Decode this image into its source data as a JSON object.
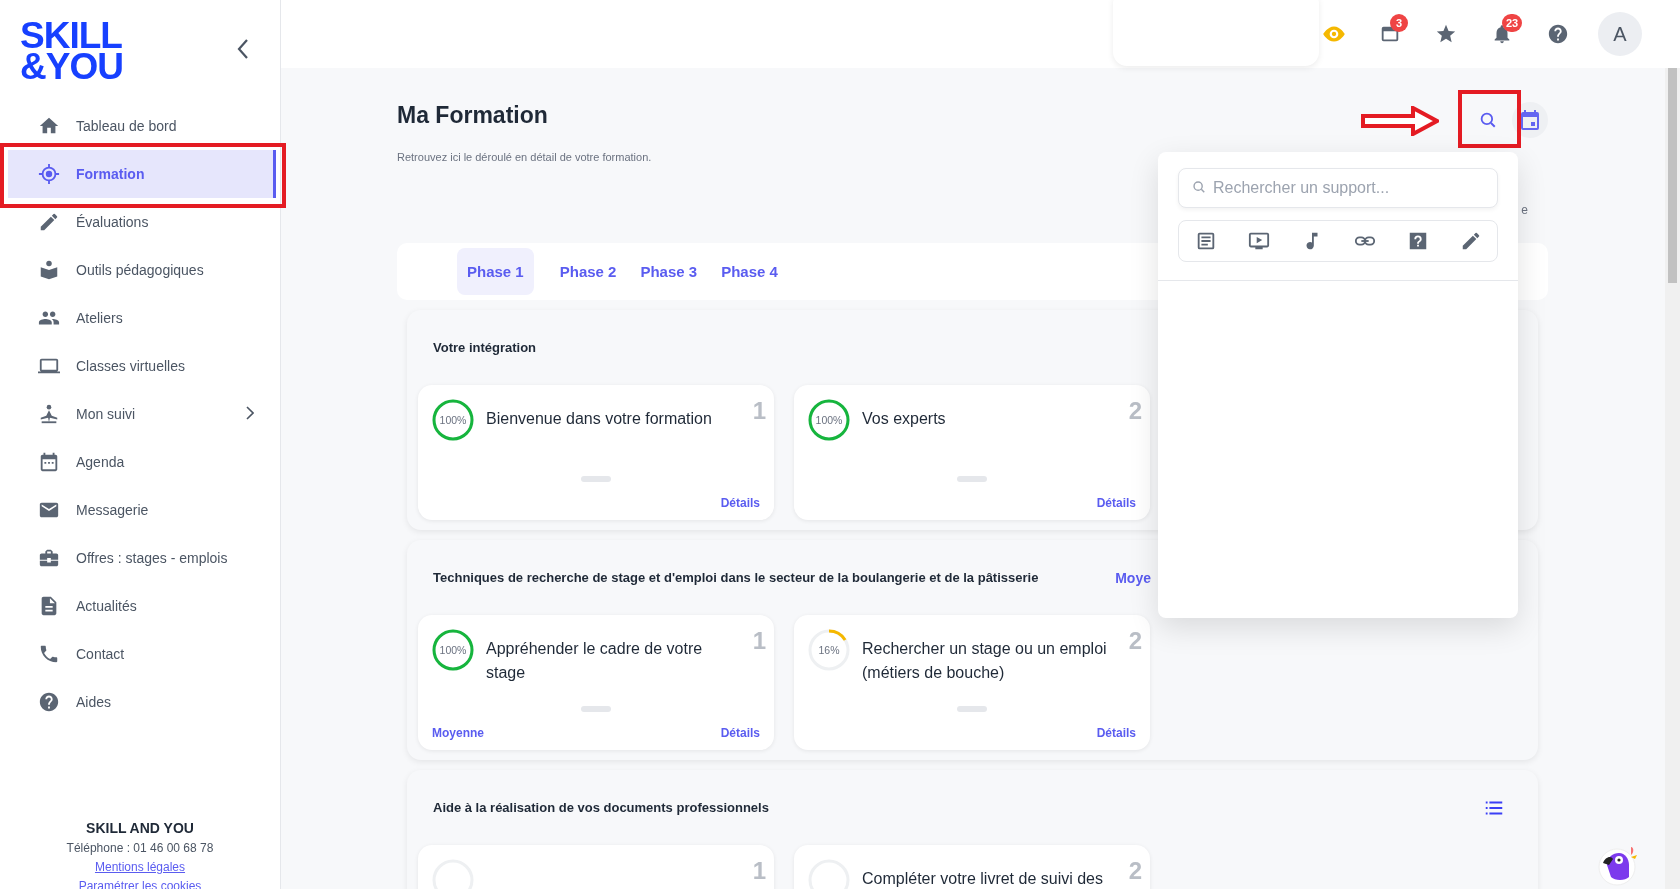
{
  "sidebar": {
    "logo": [
      "SKILL",
      "&YOU"
    ],
    "items": [
      {
        "label": "Tableau de bord",
        "selected": false,
        "expandable": false
      },
      {
        "label": "Formation",
        "selected": true,
        "expandable": false
      },
      {
        "label": "Évaluations",
        "selected": false,
        "expandable": false
      },
      {
        "label": "Outils pédagogiques",
        "selected": false,
        "expandable": false
      },
      {
        "label": "Ateliers",
        "selected": false,
        "expandable": false
      },
      {
        "label": "Classes virtuelles",
        "selected": false,
        "expandable": false
      },
      {
        "label": "Mon suivi",
        "selected": false,
        "expandable": true
      },
      {
        "label": "Agenda",
        "selected": false,
        "expandable": false
      },
      {
        "label": "Messagerie",
        "selected": false,
        "expandable": false
      },
      {
        "label": "Offres : stages - emplois",
        "selected": false,
        "expandable": false
      },
      {
        "label": "Actualités",
        "selected": false,
        "expandable": false
      },
      {
        "label": "Contact",
        "selected": false,
        "expandable": false
      },
      {
        "label": "Aides",
        "selected": false,
        "expandable": false
      }
    ],
    "footer": {
      "company": "SKILL AND YOU",
      "phone": "Téléphone : 01 46 00 68 78",
      "links": [
        "Mentions légales",
        "Paramétrer les cookies"
      ]
    }
  },
  "topbar": {
    "icons": [
      {
        "kind": "eye"
      },
      {
        "kind": "calendar",
        "badge": "3"
      },
      {
        "kind": "star"
      },
      {
        "kind": "bell",
        "badge": "23"
      },
      {
        "kind": "help"
      }
    ],
    "avatar": "A"
  },
  "page": {
    "title": "Ma Formation",
    "subtitle": "Retrouvez ici le déroulé en détail de votre formation.",
    "partial_text": "e"
  },
  "search_panel": {
    "placeholder": "Rechercher un support..."
  },
  "phases": [
    {
      "label": "Phase 1",
      "selected": true
    },
    {
      "label": "Phase 2",
      "selected": false
    },
    {
      "label": "Phase 3",
      "selected": false
    },
    {
      "label": "Phase 4",
      "selected": false
    }
  ],
  "sections": [
    {
      "title": "Votre intégration",
      "cards": [
        {
          "percent": "100%",
          "level": 1,
          "title": "Bienvenue dans votre formation",
          "number": "1",
          "details": "Détails"
        },
        {
          "percent": "100%",
          "level": 1,
          "title": "Vos experts",
          "number": "2",
          "details": "Détails"
        }
      ]
    },
    {
      "title": "Techniques de recherche de stage et d'emploi dans le secteur de la boulangerie et de la pâtisserie",
      "action": {
        "kind": "link",
        "label": "Moye"
      },
      "cards": [
        {
          "percent": "100%",
          "level": 1,
          "title": "Appréhender le cadre de votre stage",
          "number": "1",
          "rating": "Moyenne",
          "details": "Détails"
        },
        {
          "percent": "16%",
          "level": 0.16,
          "title": "Rechercher un stage ou un emploi (métiers de bouche)",
          "number": "2",
          "details": "Détails"
        }
      ]
    },
    {
      "title": "Aide à la réalisation de vos documents professionnels",
      "action": {
        "kind": "list"
      },
      "cards": [
        {
          "level": 0,
          "number": "1"
        },
        {
          "level": 0,
          "title": "Compléter votre livret de suivi des",
          "number": "2"
        }
      ]
    }
  ]
}
